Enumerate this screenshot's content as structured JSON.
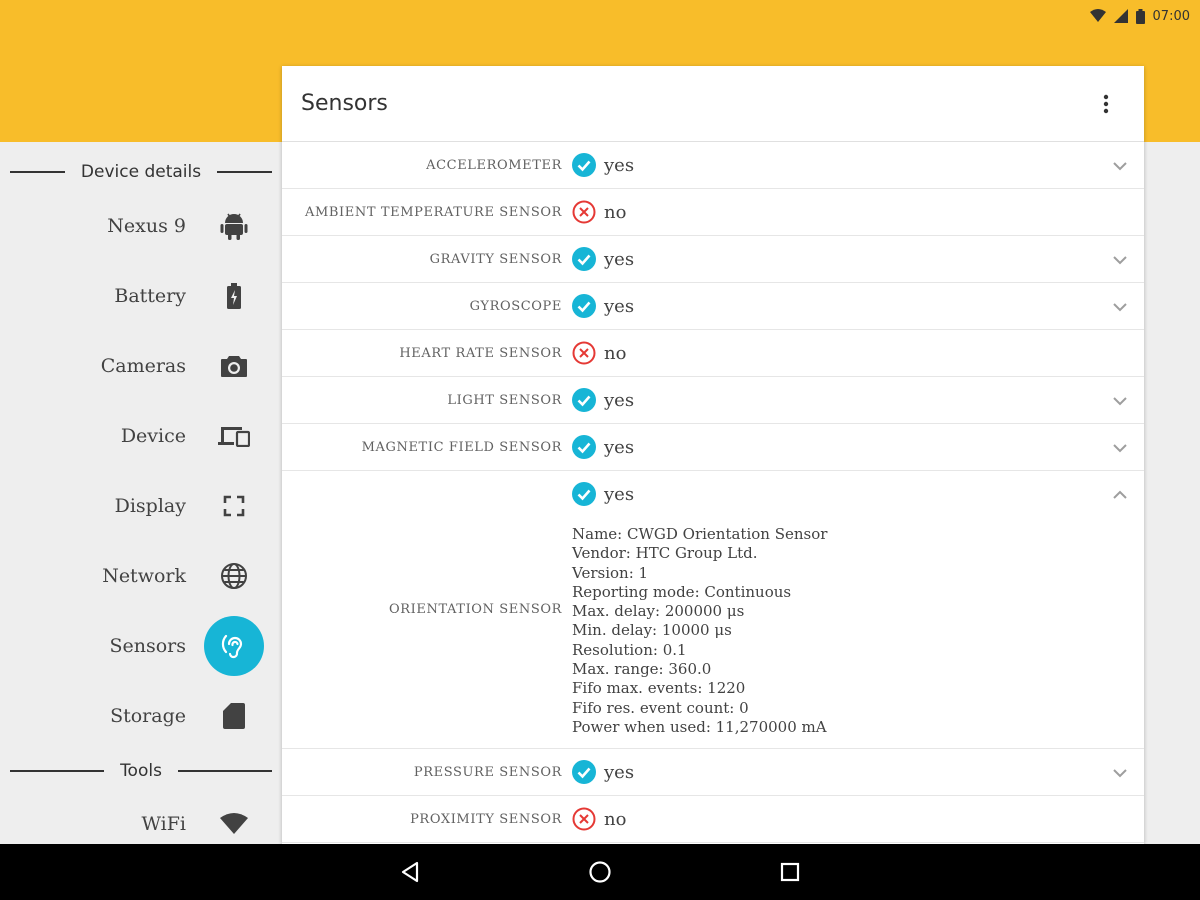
{
  "status_bar": {
    "time": "07:00"
  },
  "card": {
    "title": "Sensors"
  },
  "sidebar": {
    "sections": [
      {
        "label": "Device details"
      },
      {
        "label": "Tools"
      }
    ],
    "items": [
      {
        "label": "Nexus 9",
        "icon": "android-icon"
      },
      {
        "label": "Battery",
        "icon": "battery-icon"
      },
      {
        "label": "Cameras",
        "icon": "camera-icon"
      },
      {
        "label": "Device",
        "icon": "devices-icon"
      },
      {
        "label": "Display",
        "icon": "fullscreen-icon"
      },
      {
        "label": "Network",
        "icon": "globe-icon"
      },
      {
        "label": "Sensors",
        "icon": "ear-icon",
        "active": true
      },
      {
        "label": "Storage",
        "icon": "sd-card-icon"
      },
      {
        "label": "WiFi",
        "icon": "wifi-icon"
      }
    ]
  },
  "sensors": [
    {
      "name": "ACCELEROMETER",
      "value": "yes"
    },
    {
      "name": "AMBIENT TEMPERATURE SENSOR",
      "value": "no"
    },
    {
      "name": "GRAVITY SENSOR",
      "value": "yes"
    },
    {
      "name": "GYROSCOPE",
      "value": "yes"
    },
    {
      "name": "HEART RATE SENSOR",
      "value": "no"
    },
    {
      "name": "LIGHT SENSOR",
      "value": "yes"
    },
    {
      "name": "MAGNETIC FIELD SENSOR",
      "value": "yes"
    },
    {
      "name": "ORIENTATION SENSOR",
      "value": "yes",
      "expanded": true,
      "details": [
        "Name: CWGD Orientation Sensor",
        "Vendor: HTC Group Ltd.",
        "Version: 1",
        "Reporting mode: Continuous",
        "Max. delay: 200000 μs",
        "Min. delay: 10000 μs",
        "Resolution: 0.1",
        "Max. range: 360.0",
        "Fifo max. events: 1220",
        "Fifo res. event count: 0",
        "Power when used: 11,270000 mA"
      ]
    },
    {
      "name": "PRESSURE SENSOR",
      "value": "yes"
    },
    {
      "name": "PROXIMITY SENSOR",
      "value": "no"
    }
  ],
  "colors": {
    "accent": "#17b5d6",
    "appbar": "#f8bd2a",
    "negative": "#e53935"
  }
}
